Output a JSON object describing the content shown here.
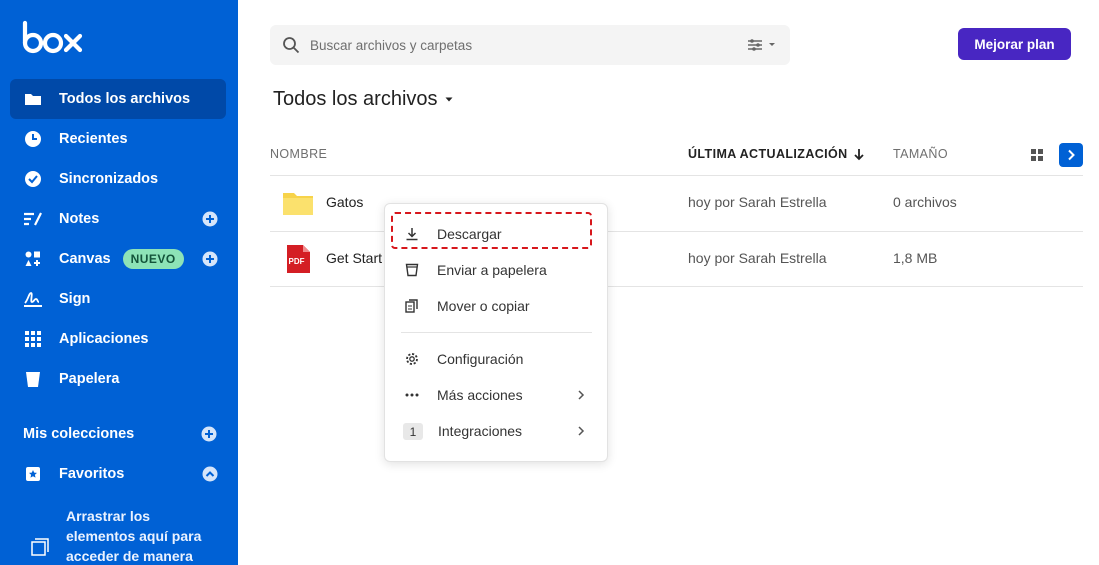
{
  "brand": {
    "logo_text": "box"
  },
  "sidebar": {
    "items": [
      {
        "label": "Todos los archivos",
        "icon": "folder-icon",
        "active": true
      },
      {
        "label": "Recientes",
        "icon": "clock-icon"
      },
      {
        "label": "Sincronizados",
        "icon": "check-circle-icon"
      },
      {
        "label": "Notes",
        "icon": "notes-icon",
        "has_add": true
      },
      {
        "label": "Canvas",
        "icon": "canvas-icon",
        "badge": "NUEVO",
        "has_add": true
      },
      {
        "label": "Sign",
        "icon": "sign-icon"
      },
      {
        "label": "Aplicaciones",
        "icon": "apps-grid-icon"
      },
      {
        "label": "Papelera",
        "icon": "trash-icon"
      }
    ],
    "collections_title": "Mis colecciones",
    "favorites_label": "Favoritos",
    "drop_hint": "Arrastrar los elementos aquí para acceder de manera"
  },
  "search": {
    "placeholder": "Buscar archivos y carpetas"
  },
  "upgrade_label": "Mejorar plan",
  "page_title": "Todos los archivos",
  "table": {
    "headers": {
      "name": "NOMBRE",
      "updated": "ÚLTIMA ACTUALIZACIÓN",
      "size": "TAMAÑO"
    },
    "rows": [
      {
        "name": "Gatos",
        "type": "folder",
        "updated": "hoy por Sarah Estrella",
        "size": "0 archivos"
      },
      {
        "name": "Get Start",
        "type": "pdf",
        "updated": "hoy por Sarah Estrella",
        "size": "1,8 MB"
      }
    ]
  },
  "context_menu": {
    "items": [
      {
        "label": "Descargar",
        "icon": "download-icon"
      },
      {
        "label": "Enviar a papelera",
        "icon": "trash-icon"
      },
      {
        "label": "Mover o copiar",
        "icon": "copy-icon"
      },
      {
        "label": "Configuración",
        "icon": "gear-icon"
      },
      {
        "label": "Más acciones",
        "icon": "more-dots-icon"
      },
      {
        "label": "Integraciones",
        "icon": "count-badge",
        "count": "1"
      }
    ]
  },
  "colors": {
    "sidebar": "#0061d5",
    "upgrade": "#4826c2",
    "highlight": "#d7171c",
    "badge": "#8de3b7"
  }
}
